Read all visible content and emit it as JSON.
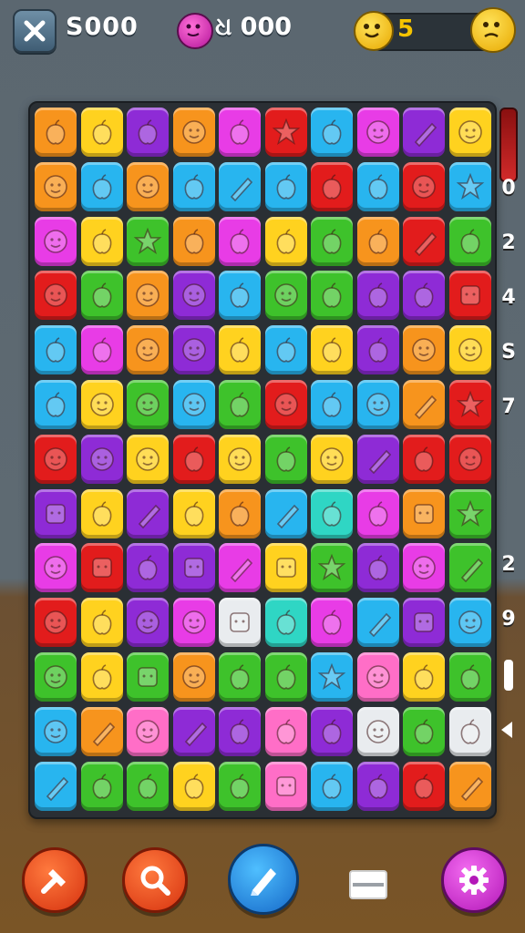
{
  "hud": {
    "score": "S000",
    "moves": "ଧ 000",
    "lives": "5"
  },
  "side_numbers": [
    "0",
    "2",
    "4",
    "S",
    "7",
    "2",
    "9"
  ],
  "colors": {
    "orange": "#f7941d",
    "yellow": "#ffd21f",
    "purple": "#8e2bd6",
    "magenta": "#e83ce6",
    "red": "#e21c1c",
    "blue": "#28b5ef",
    "green": "#3ec22b",
    "pink": "#ff6ec7",
    "white": "#e9ecef",
    "teal": "#2fd6c4"
  },
  "board": [
    [
      "orange",
      "yellow",
      "purple",
      "orange",
      "magenta",
      "red",
      "blue",
      "magenta",
      "purple",
      "yellow"
    ],
    [
      "orange",
      "blue",
      "orange",
      "blue",
      "blue",
      "blue",
      "red",
      "blue",
      "red",
      "blue"
    ],
    [
      "magenta",
      "yellow",
      "green",
      "orange",
      "magenta",
      "yellow",
      "green",
      "orange",
      "red",
      "green"
    ],
    [
      "red",
      "green",
      "orange",
      "purple",
      "blue",
      "green",
      "green",
      "purple",
      "purple",
      "red"
    ],
    [
      "blue",
      "magenta",
      "orange",
      "purple",
      "yellow",
      "blue",
      "yellow",
      "purple",
      "orange",
      "yellow"
    ],
    [
      "blue",
      "yellow",
      "green",
      "blue",
      "green",
      "red",
      "blue",
      "blue",
      "orange",
      "red"
    ],
    [
      "red",
      "purple",
      "yellow",
      "red",
      "yellow",
      "green",
      "yellow",
      "purple",
      "red",
      "red"
    ],
    [
      "purple",
      "yellow",
      "purple",
      "yellow",
      "orange",
      "blue",
      "teal",
      "magenta",
      "orange",
      "green"
    ],
    [
      "magenta",
      "red",
      "purple",
      "purple",
      "magenta",
      "yellow",
      "green",
      "purple",
      "magenta",
      "green"
    ],
    [
      "red",
      "yellow",
      "purple",
      "magenta",
      "white",
      "teal",
      "magenta",
      "blue",
      "purple",
      "blue"
    ],
    [
      "green",
      "yellow",
      "green",
      "orange",
      "green",
      "green",
      "blue",
      "pink",
      "yellow",
      "green"
    ],
    [
      "blue",
      "orange",
      "pink",
      "purple",
      "purple",
      "pink",
      "purple",
      "white",
      "green",
      "white"
    ],
    [
      "blue",
      "green",
      "green",
      "yellow",
      "green",
      "pink",
      "blue",
      "purple",
      "red",
      "orange"
    ]
  ],
  "board_icons": [
    [
      "fruit-icon",
      "fruit-icon",
      "fruit-icon",
      "face-icon",
      "fruit-icon",
      "star-icon",
      "fruit-icon",
      "face-icon",
      "stick-icon",
      "face-icon"
    ],
    [
      "face-icon",
      "fruit-icon",
      "face-icon",
      "fruit-icon",
      "stick-icon",
      "fruit-icon",
      "fruit-icon",
      "fruit-icon",
      "face-icon",
      "star-icon"
    ],
    [
      "face-icon",
      "fruit-icon",
      "star-icon",
      "fruit-icon",
      "fruit-icon",
      "fruit-icon",
      "fruit-icon",
      "fruit-icon",
      "stick-icon",
      "fruit-icon"
    ],
    [
      "face-icon",
      "fruit-icon",
      "face-icon",
      "face-icon",
      "fruit-icon",
      "face-icon",
      "fruit-icon",
      "fruit-icon",
      "fruit-icon",
      "square-icon"
    ],
    [
      "fruit-icon",
      "fruit-icon",
      "face-icon",
      "face-icon",
      "fruit-icon",
      "fruit-icon",
      "fruit-icon",
      "fruit-icon",
      "face-icon",
      "face-icon"
    ],
    [
      "fruit-icon",
      "face-icon",
      "face-icon",
      "face-icon",
      "fruit-icon",
      "face-icon",
      "fruit-icon",
      "face-icon",
      "stick-icon",
      "star-icon"
    ],
    [
      "face-icon",
      "face-icon",
      "face-icon",
      "fruit-icon",
      "face-icon",
      "fruit-icon",
      "face-icon",
      "stick-icon",
      "fruit-icon",
      "face-icon"
    ],
    [
      "square-icon",
      "fruit-icon",
      "stick-icon",
      "fruit-icon",
      "fruit-icon",
      "stick-icon",
      "fruit-icon",
      "fruit-icon",
      "square-icon",
      "star-icon"
    ],
    [
      "face-icon",
      "square-icon",
      "fruit-icon",
      "square-icon",
      "stick-icon",
      "square-icon",
      "star-icon",
      "fruit-icon",
      "face-icon",
      "stick-icon"
    ],
    [
      "face-icon",
      "fruit-icon",
      "face-icon",
      "face-icon",
      "square-icon",
      "fruit-icon",
      "fruit-icon",
      "stick-icon",
      "square-icon",
      "face-icon"
    ],
    [
      "face-icon",
      "fruit-icon",
      "square-icon",
      "face-icon",
      "fruit-icon",
      "fruit-icon",
      "star-icon",
      "face-icon",
      "fruit-icon",
      "fruit-icon"
    ],
    [
      "face-icon",
      "stick-icon",
      "face-icon",
      "stick-icon",
      "fruit-icon",
      "fruit-icon",
      "fruit-icon",
      "face-icon",
      "fruit-icon",
      "fruit-icon"
    ],
    [
      "stick-icon",
      "fruit-icon",
      "fruit-icon",
      "fruit-icon",
      "fruit-icon",
      "square-icon",
      "fruit-icon",
      "fruit-icon",
      "fruit-icon",
      "stick-icon"
    ]
  ],
  "bottom_buttons": [
    {
      "name": "hammer-button",
      "icon": "hammer-icon",
      "color": "#e8431c"
    },
    {
      "name": "search-button",
      "icon": "search-icon",
      "color": "#e8431c"
    },
    {
      "name": "pencil-button",
      "icon": "pencil-icon",
      "color": "#1f8fe0"
    },
    {
      "name": "menu-button",
      "icon": "minus-icon",
      "color": "#ffffff"
    },
    {
      "name": "settings-button",
      "icon": "gear-icon",
      "color": "#d43ad6"
    }
  ]
}
